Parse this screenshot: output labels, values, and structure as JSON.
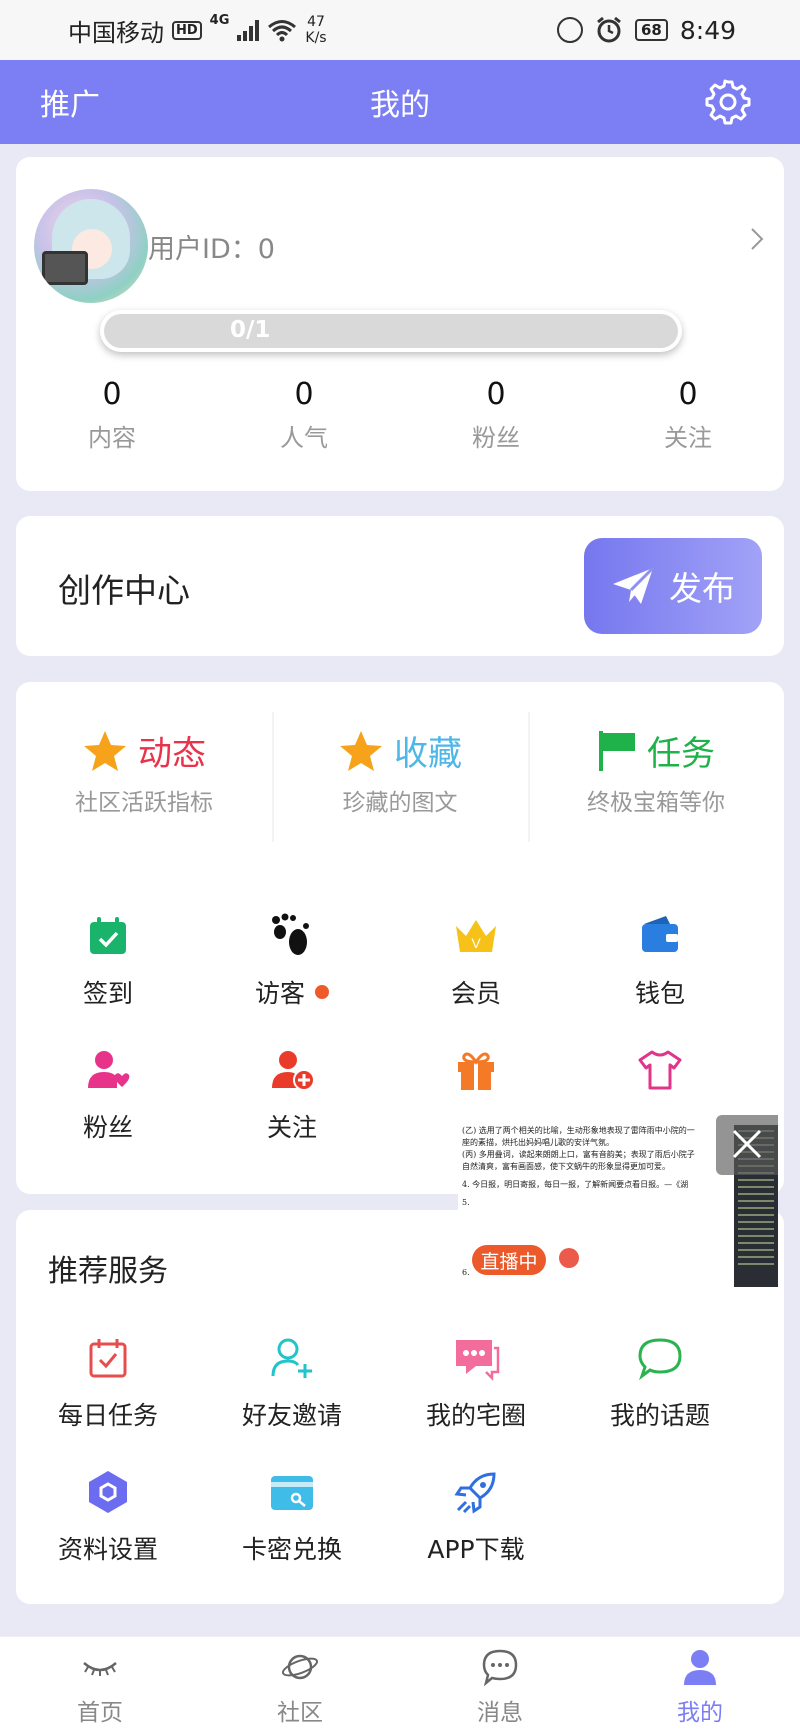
{
  "status_bar": {
    "carrier": "中国移动",
    "hd": "HD",
    "network": "4G",
    "speed_value": "47",
    "speed_unit": "K/s",
    "battery": "68",
    "time": "8:49"
  },
  "header": {
    "promo": "推广",
    "title": "我的"
  },
  "profile": {
    "user_id_label": "用户ID：",
    "user_id": "0",
    "progress_text": "0/1",
    "progress_fraction": 0,
    "stats": [
      {
        "value": "0",
        "label": "内容"
      },
      {
        "value": "0",
        "label": "人气"
      },
      {
        "value": "0",
        "label": "粉丝"
      },
      {
        "value": "0",
        "label": "关注"
      }
    ]
  },
  "creation": {
    "title": "创作中心",
    "publish": "发布"
  },
  "features": [
    {
      "title": "动态",
      "subtitle": "社区活跃指标",
      "color": "#e8334a",
      "icon": "star-icon"
    },
    {
      "title": "收藏",
      "subtitle": "珍藏的图文",
      "color": "#4fb6e8",
      "icon": "star-icon"
    },
    {
      "title": "任务",
      "subtitle": "终极宝箱等你",
      "color": "#1fb24a",
      "icon": "flag-icon"
    }
  ],
  "quick_actions": [
    {
      "label": "签到",
      "icon": "calendar-check-icon"
    },
    {
      "label": "访客",
      "icon": "footprint-icon"
    },
    {
      "label": "会员",
      "icon": "crown-icon"
    },
    {
      "label": "钱包",
      "icon": "wallet-icon"
    },
    {
      "label": "粉丝",
      "icon": "user-heart-icon"
    },
    {
      "label": "关注",
      "icon": "user-add-icon"
    },
    {
      "label": "",
      "icon": "gift-icon"
    },
    {
      "label": "",
      "icon": "shirt-icon"
    }
  ],
  "recommend": {
    "title": "推荐服务",
    "items": [
      {
        "label": "每日任务",
        "icon": "calendar-task-icon"
      },
      {
        "label": "好友邀请",
        "icon": "user-invite-icon"
      },
      {
        "label": "我的宅圈",
        "icon": "chat-bubbles-icon"
      },
      {
        "label": "我的话题",
        "icon": "speech-bubble-icon"
      },
      {
        "label": "资料设置",
        "icon": "hexagon-settings-icon"
      },
      {
        "label": "卡密兑换",
        "icon": "card-key-icon"
      },
      {
        "label": "APP下载",
        "icon": "rocket-icon"
      }
    ]
  },
  "floating_window": {
    "live_label": "直播中",
    "doc_lines": [
      "(乙) 选用了两个相关的比喻，生动形象地表现了雷阵雨中小院的一",
      "  座的素描，烘托出妈妈唱儿歌的安详气氛。",
      "(丙) 多用叠词，读起来朗朗上口，富有音韵美；表现了雨后小院子",
      "  自然清爽，富有画面感，使下文蜗牛的形象显得更加可爱。",
      "4.  今日报，明日寄报，每日一报，了解新闻要点看日报。—《湖",
      "5.",
      "6."
    ]
  },
  "bottom_nav": [
    {
      "label": "首页",
      "icon": "eye-icon",
      "active": false
    },
    {
      "label": "社区",
      "icon": "planet-icon",
      "active": false
    },
    {
      "label": "消息",
      "icon": "message-icon",
      "active": false
    },
    {
      "label": "我的",
      "icon": "person-icon",
      "active": true
    }
  ],
  "colors": {
    "primary": "#7c7ef3",
    "background": "#e9e9f6",
    "live_red": "#ec5a2c"
  }
}
